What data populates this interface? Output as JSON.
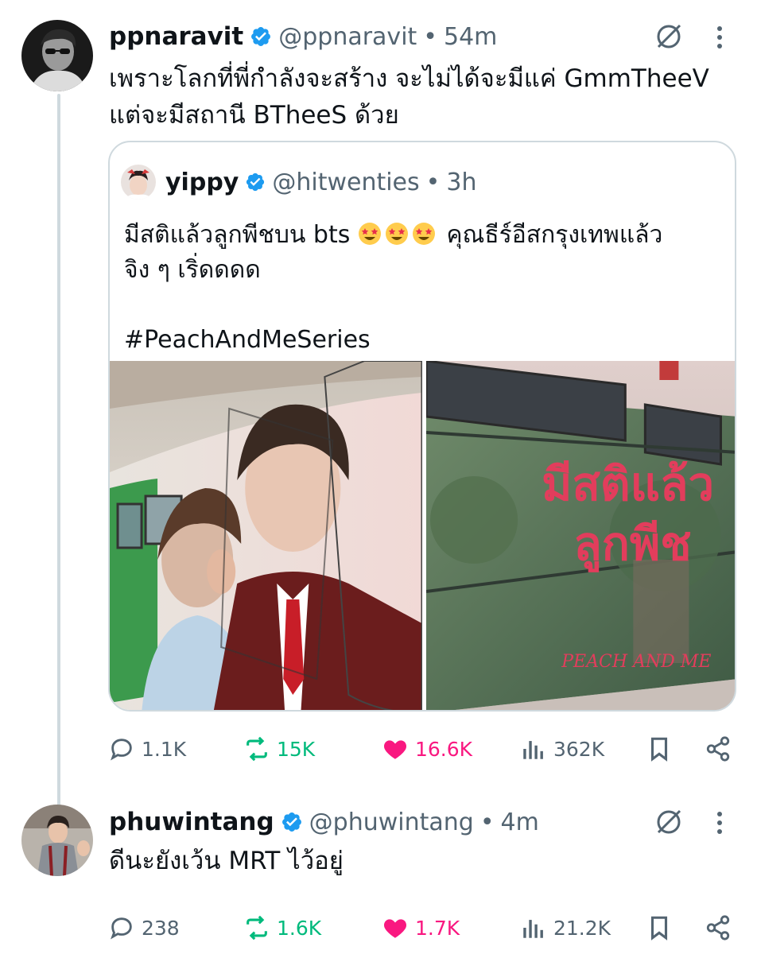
{
  "tweet1": {
    "name": "ppnaravit",
    "handle": "@ppnaravit",
    "dot": "•",
    "time": "54m",
    "text_line1": "เพราะโลกที่พี่กำลังจะสร้าง จะไม่ได้จะมีแค่ GmmTheeV",
    "text_line2": "แต่จะมีสถานี BTheeS ด้วย",
    "quote": {
      "name": "yippy",
      "handle": "@hitwenties",
      "dot": "•",
      "time": "3h",
      "line1_a": "มีสติแล้วลูกพีชบน bts",
      "line1_b": "คุณธีร์อีสกรุงเทพแล้ว",
      "line2": "จิง ๆ เริ่ดดดด",
      "line3": "#PeachAndMeSeries",
      "emoji_name": "star-struck-emoji"
    },
    "stats": {
      "replies": "1.1K",
      "reposts": "15K",
      "likes": "16.6K",
      "views": "362K"
    }
  },
  "tweet2": {
    "name": "phuwintang",
    "handle": "@phuwintang",
    "dot": "•",
    "time": "4m",
    "text": "ดีนะยังเว้น MRT ไว้อยู่",
    "stats": {
      "replies": "238",
      "reposts": "1.6K",
      "likes": "1.7K",
      "views": "21.2K"
    }
  },
  "colors": {
    "verified": "#1d9bf0",
    "repost": "#00ba7c",
    "like": "#f91880",
    "muted": "#536471",
    "border": "#cfd9de"
  }
}
